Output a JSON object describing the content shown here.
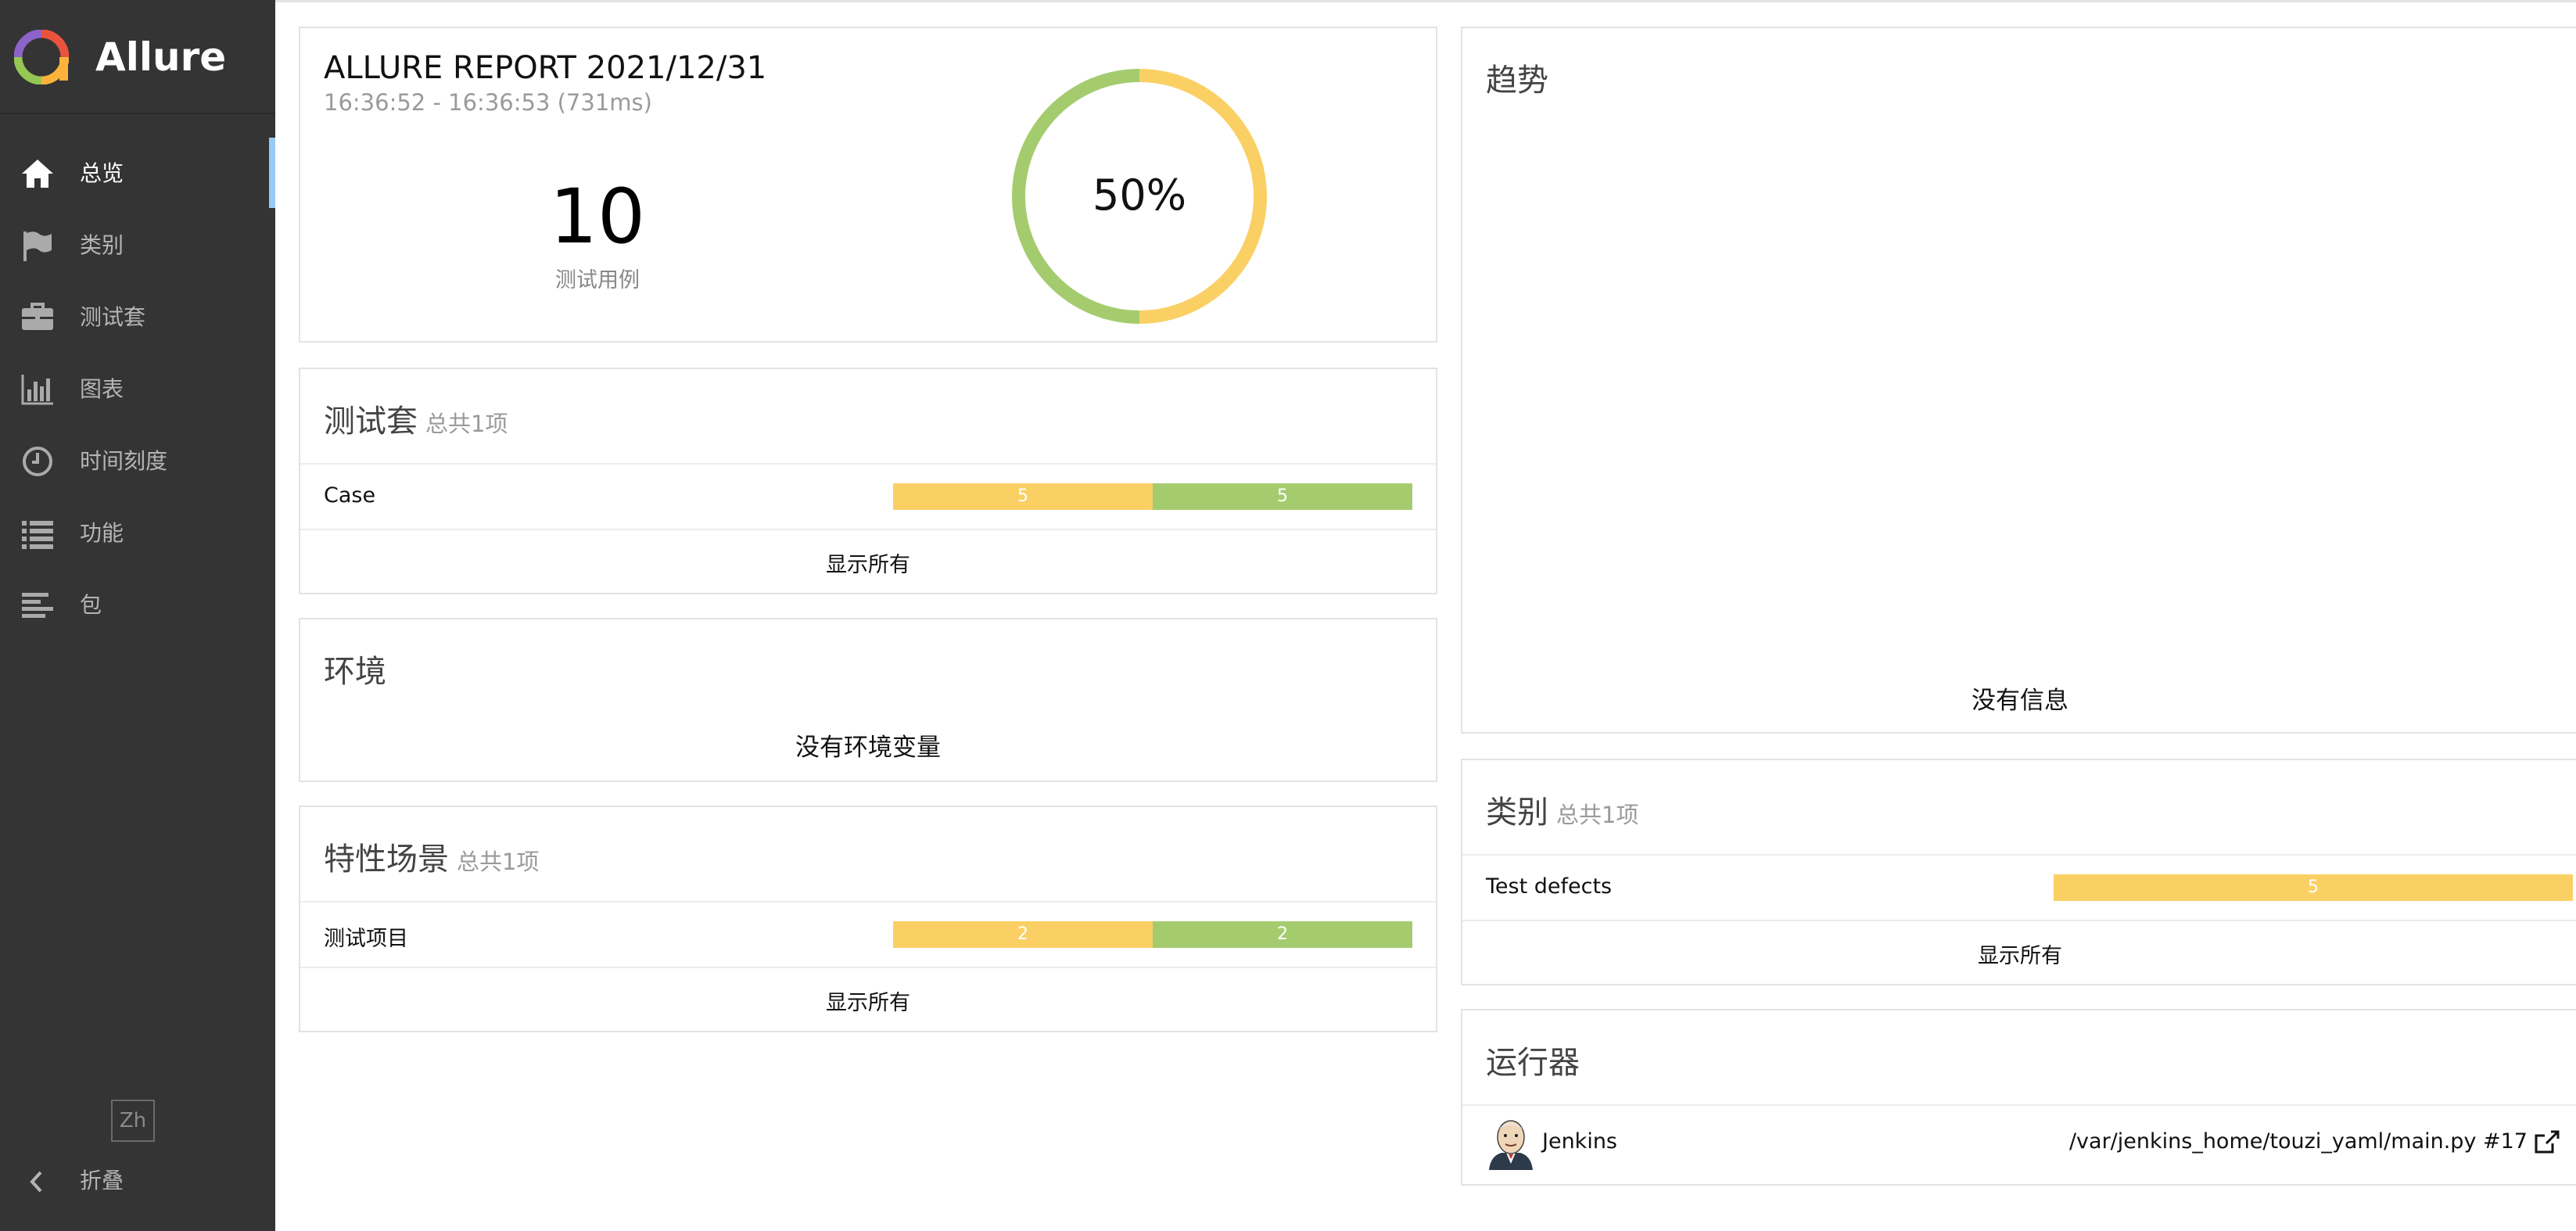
{
  "brand": {
    "name": "Allure"
  },
  "nav": {
    "items": [
      {
        "label": "总览",
        "icon": "home-icon",
        "active": true
      },
      {
        "label": "类别",
        "icon": "flag-icon"
      },
      {
        "label": "测试套",
        "icon": "briefcase-icon"
      },
      {
        "label": "图表",
        "icon": "bar-chart-icon"
      },
      {
        "label": "时间刻度",
        "icon": "clock-icon"
      },
      {
        "label": "功能",
        "icon": "list-icon"
      },
      {
        "label": "包",
        "icon": "align-left-icon"
      }
    ],
    "lang": "Zh",
    "collapse": "折叠"
  },
  "colors": {
    "broken": "#fad065",
    "passed": "#a4cc6e",
    "sidebar": "#343434",
    "active_marker": "#97cbf5"
  },
  "summary": {
    "title": "ALLURE REPORT 2021/12/31",
    "time_range": "16:36:52 - 16:36:53 (731ms)",
    "count": "10",
    "count_label": "测试用例",
    "percent_label": "50%",
    "donut": {
      "broken_fraction": 0.5,
      "passed_fraction": 0.5
    }
  },
  "suites": {
    "title": "测试套",
    "subtitle": "总共1项",
    "rows": [
      {
        "name": "Case",
        "broken": "5",
        "passed": "5"
      }
    ],
    "show_all": "显示所有"
  },
  "environment": {
    "title": "环境",
    "empty": "没有环境变量"
  },
  "features": {
    "title": "特性场景",
    "subtitle": "总共1项",
    "rows": [
      {
        "name": "测试项目",
        "broken": "2",
        "passed": "2"
      }
    ],
    "show_all": "显示所有"
  },
  "trend": {
    "title": "趋势",
    "empty": "没有信息"
  },
  "categories": {
    "title": "类别",
    "subtitle": "总共1项",
    "rows": [
      {
        "name": "Test defects",
        "value": "5"
      }
    ],
    "show_all": "显示所有"
  },
  "executors": {
    "title": "运行器",
    "rows": [
      {
        "name": "Jenkins",
        "link": "/var/jenkins_home/touzi_yaml/main.py #17"
      }
    ]
  }
}
